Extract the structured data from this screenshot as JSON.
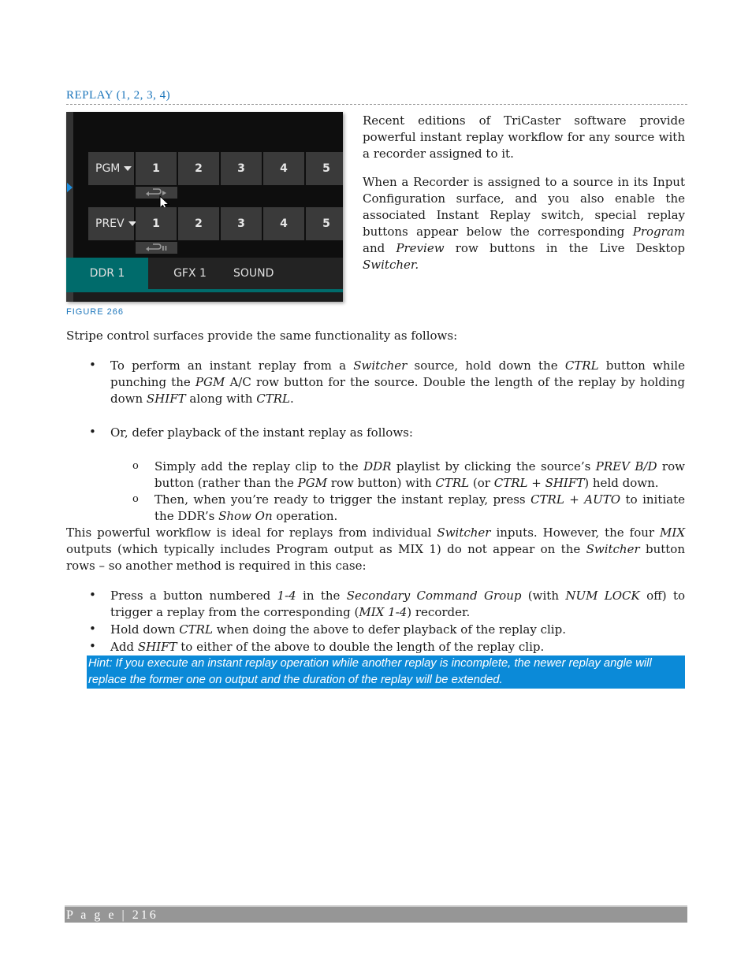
{
  "section": {
    "title": "REPLAY (1, 2, 3, 4)"
  },
  "figure": {
    "pgm_label": "PGM",
    "prev_label": "PREV",
    "buttons": [
      "1",
      "2",
      "3",
      "4",
      "5"
    ],
    "tabs": [
      "DDR 1",
      "GFX 1",
      "SOUND"
    ],
    "active_tab": "DDR 1",
    "caption": "FIGURE 266",
    "icons": [
      "replay-play-icon",
      "replay-pause-icon",
      "mouse-cursor-icon",
      "dropdown-caret-icon"
    ],
    "colors": {
      "accent_teal": "#006b6b",
      "marker_blue": "#1e8fe0"
    }
  },
  "intro": {
    "p1": "Recent editions of TriCaster software provide powerful instant replay workflow for any source with a recorder assigned to it.",
    "p2_a": "When a Recorder is assigned to a source in its Input Configuration surface, and you also enable the associated Instant Replay switch, special replay buttons appear below the corresponding ",
    "p2_program": "Program",
    "p2_and": " and ",
    "p2_preview": "Preview",
    "p2_b": " row buttons in the Live Desktop ",
    "p2_switcher": "Switcher."
  },
  "stripe": {
    "lead": "Stripe control surfaces provide the same functionality as follows:",
    "bullet1": {
      "t1": "To perform an instant replay from a ",
      "switcher": "Switcher",
      "t2": " source, hold down the ",
      "ctrl": "CTRL",
      "t3": " button while punching the ",
      "pgm": "PGM",
      "t4": " A/C row button for the source. Double the length of the replay by holding down ",
      "shift": "SHIFT",
      "t5": " along with ",
      "ctrl2": "CTRL",
      "t6": "."
    },
    "bullet2": "Or, defer playback of the instant replay as follows:",
    "sub1": {
      "t1": "Simply add the replay clip to the ",
      "ddr": "DDR",
      "t2": " playlist by clicking the source’s ",
      "prevbd": "PREV B/D",
      "t3": " row button (rather than the ",
      "pgm": "PGM",
      "t4": " row button) with ",
      "ctrl": "CTRL",
      "t5": " (or ",
      "ctrlshift": "CTRL + SHIFT",
      "t6": ") held down."
    },
    "sub2": {
      "t1": "Then, when you’re ready to trigger the instant replay, press ",
      "ctrlauto": "CTRL + AUTO",
      "t2": " to initiate the DDR’s ",
      "showon": "Show On",
      "t3": " operation."
    }
  },
  "mix": {
    "t1": "This powerful workflow is ideal for replays from individual ",
    "switcher": "Switcher",
    "t2": " inputs. However, the four ",
    "mix": "MIX",
    "t3": " outputs (which typically includes Program output as MIX 1) do not appear on the ",
    "switcher2": "Switcher",
    "t4": " button rows – so another method is required in this case:",
    "b1": {
      "t1": "Press a button numbered ",
      "range": "1-4",
      "t2": " in the ",
      "scg": "Secondary Command Group",
      "t3": " (with ",
      "numlock": "NUM LOCK",
      "t4": " off) to trigger a replay from the corresponding (",
      "mixr": "MIX 1-4",
      "t5": ") recorder."
    },
    "b2": {
      "t1": "Hold down ",
      "ctrl": "CTRL",
      "t2": " when doing the above to defer playback of the replay clip."
    },
    "b3": {
      "t1": "Add ",
      "shift": "SHIFT",
      "t2": " to either of the above to double the length of the replay clip."
    }
  },
  "hint": "Hint: If you execute an instant replay operation while another replay is incomplete, the newer replay angle will replace the former one on output and the duration of the replay will be extended.",
  "footer": {
    "page_label": "P a g e | 216"
  }
}
